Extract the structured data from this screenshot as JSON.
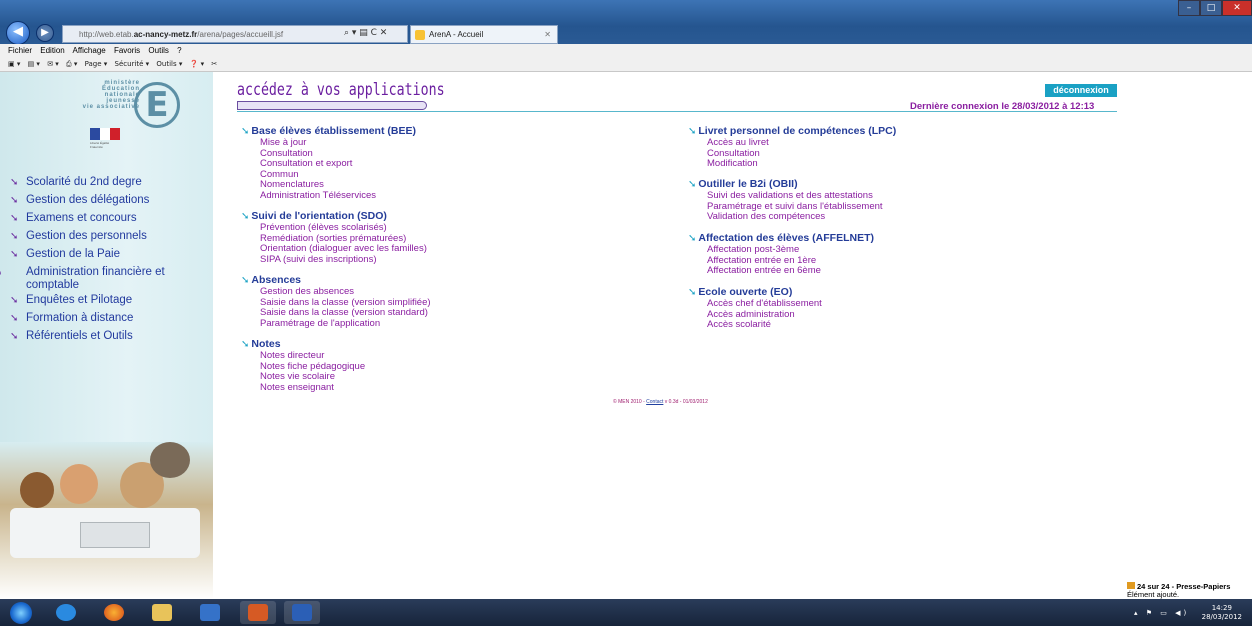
{
  "browser": {
    "url_prefix": "http://web.etab.",
    "url_domain": "ac-nancy-metz.fr",
    "url_path": "/arena/pages/accueill.jsf",
    "url_controls": "⌕ ▾ ▤ C ✕",
    "tab_title": "ArenA - Accueil",
    "tab_close": "✕",
    "window_controls": [
      "–",
      "□",
      "✕"
    ],
    "right_tools": "⌂★⚙",
    "menu": [
      "Fichier",
      "Edition",
      "Affichage",
      "Favoris",
      "Outils",
      "?"
    ],
    "commands": [
      "▣ ▾",
      "▤ ▾",
      "✉ ▾",
      "⎙ ▾",
      "Page ▾",
      "Sécurité ▾",
      "Outils ▾",
      "❓ ▾",
      "✂"
    ]
  },
  "sidebar": {
    "logo_text": "ministère\nÉducation\nnationale\njeunesse\nvie associative",
    "logo_letter": "E",
    "flag_caption": "Liberté Égalité Fraternité",
    "items": [
      {
        "label": "Scolarité du 2nd degre"
      },
      {
        "label": "Gestion des délégations"
      },
      {
        "label": "Examens et concours"
      },
      {
        "label": "Gestion des personnels"
      },
      {
        "label": "Gestion de la Paie"
      },
      {
        "label": "Administration financière et comptable"
      },
      {
        "label": "Enquêtes et Pilotage"
      },
      {
        "label": "Formation à distance"
      },
      {
        "label": "Référentiels et Outils"
      }
    ]
  },
  "main": {
    "title": "accédez à vos applications",
    "logout": "déconnexion",
    "last_connection": "Dernière connexion le 28/03/2012 à 12:13",
    "footer_pre": "© MEN 2010 - ",
    "footer_link": "Contact",
    "footer_post": " v 0.3d - 01/03/2012",
    "sections": [
      {
        "title": "Base élèves établissement (BEE)",
        "items": [
          "Mise à jour",
          "Consultation",
          "Consultation et export",
          "Commun",
          "Nomenclatures",
          "Administration Téléservices"
        ]
      },
      {
        "title": "Suivi de l'orientation (SDO)",
        "items": [
          "Prévention (élèves scolarisés)",
          "Remédiation (sorties prématurées)",
          "Orientation (dialoguer avec les familles)",
          "SIPA (suivi des inscriptions)"
        ]
      },
      {
        "title": "Absences",
        "items": [
          "Gestion des absences",
          "Saisie dans la classe (version simplifiée)",
          "Saisie dans la classe (version standard)",
          "Paramétrage de l'application"
        ]
      },
      {
        "title": "Notes",
        "items": [
          "Notes directeur",
          "Notes fiche pédagogique",
          "Notes vie scolaire",
          "Notes enseignant"
        ]
      },
      {
        "title": "Livret personnel de compétences (LPC)",
        "items": [
          "Accès au livret",
          "Consultation",
          "Modification"
        ]
      },
      {
        "title": "Outiller le B2i (OBII)",
        "items": [
          "Suivi des validations et des attestations",
          "Paramétrage et suivi dans l'établissement",
          "Validation des compétences"
        ]
      },
      {
        "title": "Affectation des élèves (AFFELNET)",
        "items": [
          "Affectation post-3ème",
          "Affectation entrée en 1ère",
          "Affectation entrée en 6ème"
        ]
      },
      {
        "title": "Ecole ouverte (EO)",
        "items": [
          "Accès chef d'établissement",
          "Accès administration",
          "Accès scolarité"
        ]
      }
    ]
  },
  "notification": {
    "line1": "24 sur 24 - Presse-Papiers",
    "line2": "Élément ajouté."
  },
  "taskbar": {
    "time": "14:29",
    "date": "28/03/2012",
    "tray_icons": "▴ ⚑ ▭ ◀)"
  },
  "colors": {
    "accent": "#1aa1c4",
    "link": "#8a1ea0",
    "heading": "#243c98",
    "title": "#6b1fa0"
  }
}
